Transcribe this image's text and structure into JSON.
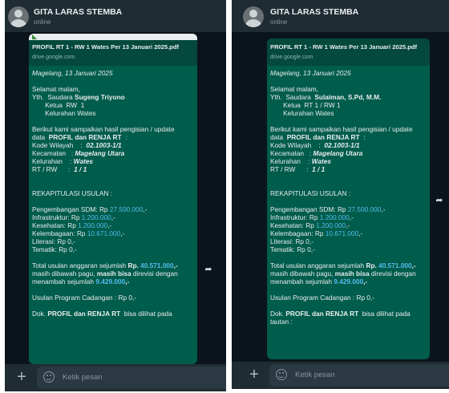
{
  "left": {
    "header": {
      "name": "GITA LARAS STEMBA",
      "status": "online"
    },
    "link_preview": {
      "title": "PROFIL RT 1 - RW 1 Wates Per 13 Januari 2025.pdf",
      "domain": "drive.google.com"
    },
    "message": {
      "date": "Magelang, 13 Januari 2025",
      "greeting": "Selamat malam,",
      "yth_prefix": "Yth.  Saudara ",
      "yth_name": "Sugeng Triyono",
      "ketua": "       Ketua  RW  1",
      "kelurahan_line": "       Kelurahan Wates",
      "intro1": "Berikut kami sampaikan hasil pengisian / update",
      "intro2_prefix": "data  ",
      "intro2_bold": "PROFIL dan RENJA RT",
      "intro2_suffix": "  :",
      "kode_label": "Kode Wilayah    :  ",
      "kode_value": "02.1003-1/1",
      "kec_label": "Kecamatan   : ",
      "kec_value": "Magelang Utara",
      "kel_label": "Kelurahan    : ",
      "kel_value": "Wates",
      "rtrw_label": "RT / RW      :  ",
      "rtrw_value": "1 / 1",
      "rekap": "REKAPITULASI USULAN :",
      "sdm_label": "Pengembangan SDM: Rp ",
      "sdm_value": "27.500.000",
      "sdm_suffix": ",-",
      "infra_label": "Infrastruktur: Rp ",
      "infra_value": "1.200.000",
      "infra_suffix": ",-",
      "kes_label": "Kesehatan: Rp ",
      "kes_value": "1.200.000",
      "kes_suffix": ",-",
      "kel2_label": "Kelembagaan: Rp ",
      "kel2_value": "10.671.000",
      "kel2_suffix": ",-",
      "literasi": "Literasi: Rp 0,-",
      "tematik": "Tematik: Rp 0,-",
      "total_prefix": "Total usulan anggaran sejumlah ",
      "total_rp": "Rp. ",
      "total_value": "40.571.000",
      "total_suffix": ",-",
      "pagu_prefix": "masih dibawah pagu, ",
      "pagu_bold": "masih bisa",
      "pagu_suffix": " direvisi dengan",
      "tambah_prefix": "menambah sejumlah ",
      "tambah_value": "9.429.000",
      "tambah_suffix": ",-",
      "cadangan": "Usulan Program Cadangan : Rp 0,-",
      "dok_prefix": "Dok. ",
      "dok_bold": "PROFIL dan RENJA RT",
      "dok_suffix": "  bisa dilihat pada"
    },
    "footer": {
      "placeholder": "Ketik pesan"
    }
  },
  "right": {
    "header": {
      "name": "GITA LARAS STEMBA",
      "status": "online"
    },
    "link_preview": {
      "title": "PROFIL RT 1 - RW 1 Wates Per 13 Januari 2025.pdf",
      "domain": "drive.google.com"
    },
    "message": {
      "date": "Magelang, 13 Januari 2025",
      "greeting": "Selamat malam,",
      "yth_prefix": "Yth.  Saudara  ",
      "yth_name": "Sulaiman, S.Pd, M.M.",
      "ketua": "       Ketua  RT 1 / RW 1",
      "kelurahan_line": "       Kelurahan Wates",
      "intro1": "Berikut kami sampaikan hasil pengisian / update",
      "intro2_prefix": "data  ",
      "intro2_bold": "PROFIL dan RENJA RT",
      "intro2_suffix": "  :",
      "kode_label": "Kode Wilayah    :  ",
      "kode_value": "02.1003-1/1",
      "kec_label": "Kecamatan   : ",
      "kec_value": "Magelang Utara",
      "kel_label": "Kelurahan    : ",
      "kel_value": "Wates",
      "rtrw_label": "RT / RW      :  ",
      "rtrw_value": "1 / 1",
      "rekap": "REKAPITULASI USULAN :",
      "sdm_label": "Pengembangan SDM: Rp ",
      "sdm_value": "27.500.000",
      "sdm_suffix": ",-",
      "infra_label": "Infrastruktur: Rp ",
      "infra_value": "1.200.000",
      "infra_suffix": ",-",
      "kes_label": "Kesehatan: Rp ",
      "kes_value": "1.200.000",
      "kes_suffix": ",-",
      "kel2_label": "Kelembagaan: Rp ",
      "kel2_value": "10.671.000",
      "kel2_suffix": ",-",
      "literasi": "Literasi: Rp 0,-",
      "tematik": "Tematik: Rp 0,-",
      "total_prefix": "Total usulan anggaran sejumlah ",
      "total_rp": "Rp. ",
      "total_value": "40.571.000",
      "total_suffix": ",-",
      "pagu_prefix": "masih dibawah pagu, ",
      "pagu_bold": "masih bisa",
      "pagu_suffix": " direvisi dengan",
      "tambah_prefix": "menambah sejumlah ",
      "tambah_value": "9.429.000",
      "tambah_suffix": ",-",
      "cadangan": "Usulan Program Cadangan : Rp 0,-",
      "dok_prefix": "Dok. ",
      "dok_bold": "PROFIL dan RENJA RT",
      "dok_suffix": "  bisa dilihat pada",
      "tautan": "tautan :"
    },
    "footer": {
      "placeholder": "Ketik pesan"
    }
  },
  "icons": {
    "forward": "forward-arrow-icon",
    "plus": "plus-icon",
    "emoji": "emoji-icon",
    "avatar": "default-avatar-icon",
    "preview_image": "image-icon"
  },
  "colors": {
    "chat_bg": "#0b141a",
    "header_bg": "#202c33",
    "bubble_out": "#005c4b",
    "link": "#53bdeb",
    "text": "#e9edef",
    "muted": "#8696a0"
  }
}
